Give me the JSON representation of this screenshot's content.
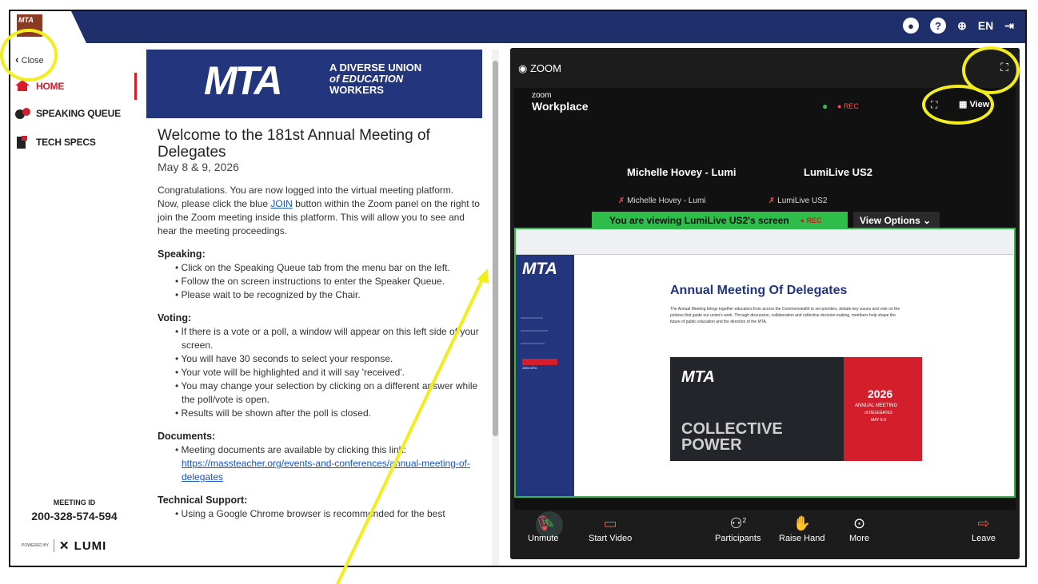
{
  "topbar": {
    "lang": "EN"
  },
  "sidebar": {
    "close_label": "Close",
    "items": [
      {
        "label": "HOME"
      },
      {
        "label": "SPEAKING QUEUE"
      },
      {
        "label": "TECH SPECS"
      }
    ],
    "meeting_id_label": "MEETING ID",
    "meeting_id": "200-328-574-594",
    "powered_by": "POWERED BY",
    "lumi": "LUMI"
  },
  "banner": {
    "mta": "MTA",
    "tag1": "A DIVERSE UNION",
    "tag2": "of EDUCATION",
    "tag3": "WORKERS"
  },
  "content": {
    "title": "Welcome to the 181st Annual Meeting of Delegates",
    "date": "May 8 & 9, 2026",
    "intro1": "Congratulations. You are now logged into the virtual meeting platform.",
    "intro2a": "Now, please click the blue ",
    "intro2_join": "JOIN",
    "intro2b": " button within the Zoom panel on the right to join the Zoom meeting inside this platform. This will allow you to see and hear the meeting proceedings.",
    "speaking_h": "Speaking:",
    "speaking": [
      "• Click on the Speaking Queue tab from the menu bar on the left.",
      "• Follow the on screen instructions to enter the Speaker Queue.",
      "• Please wait to be recognized by the Chair."
    ],
    "voting_h": "Voting:",
    "voting": [
      "• If there is a vote or a poll, a window will appear on this left side of your screen.",
      "• You will have 30 seconds to select your response.",
      "• Your vote will be highlighted and it will say 'received'.",
      "• You may change your selection by clicking on a different answer while the poll/vote is open.",
      "• Results will be shown after the poll is closed."
    ],
    "docs_h": "Documents:",
    "docs_text": "• Meeting documents are available by clicking this link:",
    "docs_link": "https://massteacher.org/events-and-conferences/annual-meeting-of-delegates",
    "tech_h": "Technical Support:",
    "tech_text": "• Using a Google Chrome browser is recommended for the best"
  },
  "zoom": {
    "label": "ZOOM",
    "wp_small": "zoom",
    "wp_big": "Workplace",
    "rec": "REC",
    "view": "View",
    "tile1": "Michelle Hovey - Lumi",
    "tile2": "LumiLive US2",
    "sub1": "Michelle Hovey - Lumi",
    "sub2": "LumiLive US2",
    "viewing": "You are viewing  LumiLive US2's screen",
    "view_options": "View Options",
    "controls": [
      {
        "label": "Unmute"
      },
      {
        "label": "Start Video"
      },
      {
        "label": "Participants"
      },
      {
        "label": "Raise Hand"
      },
      {
        "label": "More"
      },
      {
        "label": "Leave"
      }
    ],
    "participants_count": "2"
  },
  "shared_screen": {
    "mta": "MTA",
    "title": "Annual Meeting Of Delegates",
    "text": "The Annual Meeting brings together educators from across the Commonwealth to set priorities, debate key issues and vote on the policies that guide our union's work. Through discussion, collaboration and collective decision-making, members help shape the future of public education and the direction of the MTA.",
    "poster_year": "2026",
    "poster_line": "ANNUAL MEETING",
    "poster_sub": "of DELEGATES",
    "poster_dates": "MAY 8-9",
    "collective1": "COLLECTIVE",
    "collective2": "POWER",
    "join_btn": "JOIN MTA"
  },
  "colors": {
    "navy": "#1f2f6b",
    "red": "#d41e2c",
    "green": "#2ebc4b",
    "highlight": "#f2ee1e"
  }
}
